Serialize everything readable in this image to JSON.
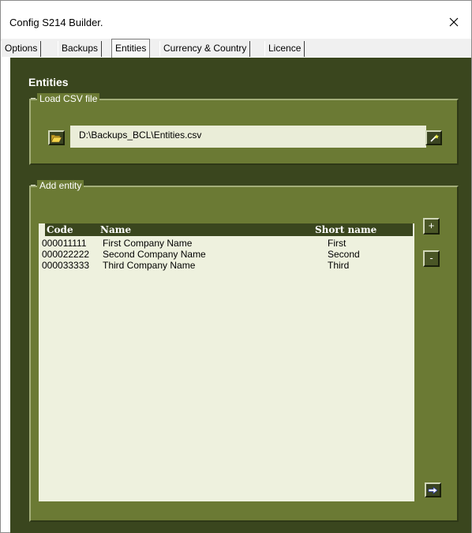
{
  "window": {
    "title": "Config S214 Builder."
  },
  "tabs": [
    {
      "label": "Options",
      "active": false
    },
    {
      "label": "Backups",
      "active": false
    },
    {
      "label": "Entities",
      "active": true
    },
    {
      "label": "Currency & Country",
      "active": false
    },
    {
      "label": "Licence",
      "active": false
    }
  ],
  "page": {
    "title": "Entities"
  },
  "load_csv": {
    "legend": "Load CSV file",
    "path": "D:\\Backups_BCL\\Entities.csv",
    "open_icon": "folder-open-icon",
    "load_icon": "wand-icon"
  },
  "add_entity": {
    "legend": "Add entity",
    "columns": [
      "Code",
      "Name",
      "Short name"
    ],
    "rows": [
      [
        "000011111",
        "First Company Name",
        "First"
      ],
      [
        "000022222",
        "Second Company Name",
        "Second"
      ],
      [
        "000033333",
        "Third Company Name",
        "Third"
      ]
    ],
    "add_label": "+",
    "remove_label": "-",
    "next_icon": "arrow-right-icon"
  },
  "colors": {
    "background_dark": "#3a461e",
    "frame": "#6b7a34",
    "list_bg": "#eef1de",
    "field_bg": "#eaedd8"
  }
}
